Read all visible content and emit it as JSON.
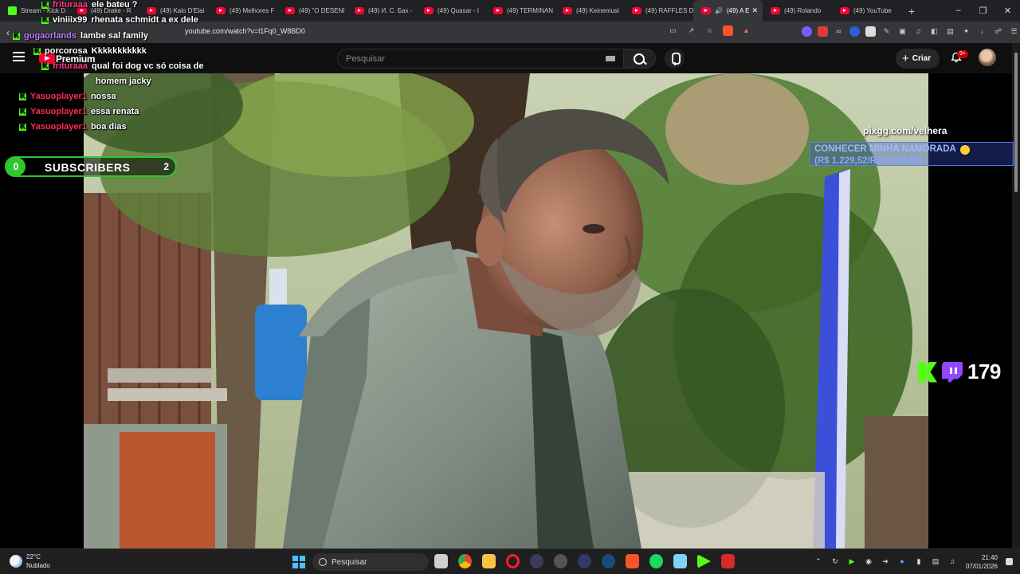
{
  "browser": {
    "tabs": [
      {
        "title": "Stream - Kick D",
        "kind": "kick"
      },
      {
        "title": "(49) Drake - R",
        "kind": "youtube"
      },
      {
        "title": "(49) Kaio D'Elai",
        "kind": "youtube"
      },
      {
        "title": "(49) Melhores F",
        "kind": "youtube"
      },
      {
        "title": "(49) \"O DESENI",
        "kind": "youtube"
      },
      {
        "title": "(49) И. С. Бах -",
        "kind": "youtube"
      },
      {
        "title": "(49) Quasar - I",
        "kind": "youtube"
      },
      {
        "title": "(49) TERMINAN",
        "kind": "youtube"
      },
      {
        "title": "(49) Keinemusi",
        "kind": "youtube"
      },
      {
        "title": "(49) RAFFLES D",
        "kind": "youtube"
      },
      {
        "title": "(49) A E",
        "kind": "youtube",
        "active": true
      },
      {
        "title": "(49) Rolando",
        "kind": "youtube"
      },
      {
        "title": "(49) YouTube",
        "kind": "youtube"
      }
    ],
    "url": "youtube.com/watch?v=l1Fq0_W8BD0"
  },
  "youtube": {
    "logo_text": "Premium",
    "search_placeholder": "Pesquisar",
    "create_label": "Criar",
    "notif_badge": "9+"
  },
  "overlay": {
    "chat": [
      {
        "user": "frituraaa",
        "msg": "ele bateu ?",
        "color": "#ff3b8b"
      },
      {
        "user": "viniiix99",
        "msg": "rhenata schmidt a ex dele",
        "color": "#ffffff"
      },
      {
        "user": "gugaorlands",
        "msg": "lambe sal family",
        "color": "#c77dff"
      },
      {
        "user": "porcorosa",
        "msg": "Kkkkkkkkkkk",
        "color": "#ffffff"
      },
      {
        "user": "frituraaa",
        "msg": "qual foi dog vc só coisa de",
        "color": "#ff3b8b"
      },
      {
        "user": "",
        "msg": "homem jacky",
        "color": "#ffffff"
      },
      {
        "user": "Yasuoplayer1",
        "msg": "nossa",
        "color": "#ff2a55"
      },
      {
        "user": "Yasuoplayer1",
        "msg": "essa renata",
        "color": "#ff2a55"
      },
      {
        "user": "Yasuoplayer1",
        "msg": "boa dias",
        "color": "#ff2a55"
      }
    ],
    "subs": {
      "count": "0",
      "label": "SUBSCRIBERS",
      "goal": "2"
    },
    "pix_tag": "pixgg.com/velhera",
    "goal_title": "CONHECER MINHA NAMORADA",
    "goal_amount": "(R$ 1.229,52/R$ 3.000,00)",
    "viewer_count": "179"
  },
  "taskbar": {
    "temperature": "22°C",
    "weather": "Nublado",
    "search_label": "Pesquisar",
    "time": "21:40",
    "date": "07/01/2026"
  },
  "colors": {
    "kick": "#53fc18",
    "twitch": "#9146ff",
    "youtube_red": "#ff0033",
    "sub_green": "#2dc92d"
  }
}
